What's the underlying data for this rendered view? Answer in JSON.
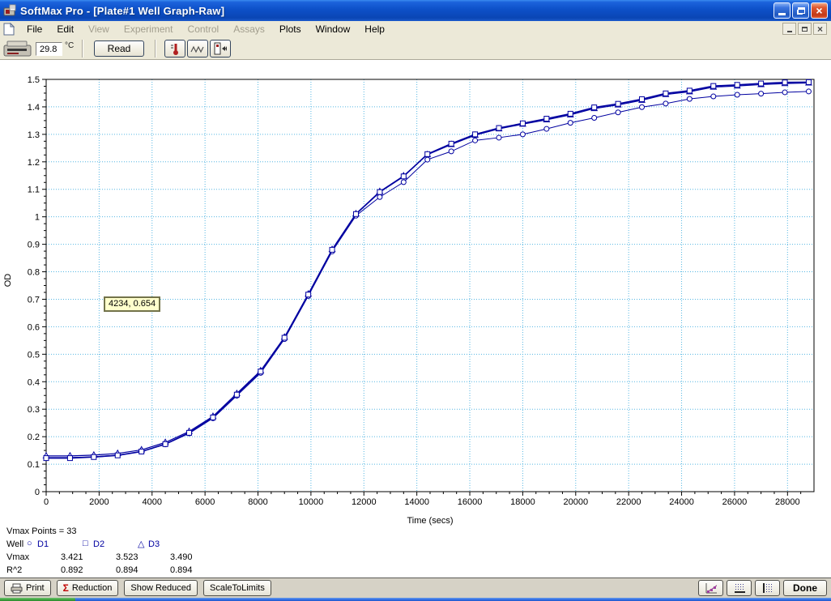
{
  "window": {
    "title": "SoftMax Pro - [Plate#1 Well Graph-Raw]",
    "controls": {
      "minimize": "minimize",
      "restore": "restore",
      "close": "×"
    }
  },
  "menu": {
    "items": [
      {
        "label": "File",
        "enabled": true
      },
      {
        "label": "Edit",
        "enabled": true
      },
      {
        "label": "View",
        "enabled": false
      },
      {
        "label": "Experiment",
        "enabled": false
      },
      {
        "label": "Control",
        "enabled": false
      },
      {
        "label": "Assays",
        "enabled": false
      },
      {
        "label": "Plots",
        "enabled": true
      },
      {
        "label": "Window",
        "enabled": true
      },
      {
        "label": "Help",
        "enabled": true
      }
    ]
  },
  "toolbar": {
    "temperature": "29.8",
    "temperature_unit": "°C",
    "read_label": "Read",
    "icon_buttons": [
      "thermometer-icon",
      "kinetic-waveform-icon",
      "plate-in-out-icon"
    ]
  },
  "tooltip": {
    "text": "4234, 0.654",
    "bg": "#FFFFCC"
  },
  "chart_data": {
    "type": "line",
    "title": "",
    "xlabel": "Time (secs)",
    "ylabel": "OD",
    "xlim": [
      0,
      29000
    ],
    "ylim": [
      0,
      1.5
    ],
    "grid": true,
    "grid_color": "#55B6E2",
    "line_color": "#0000A0",
    "x_ticks": [
      0,
      2000,
      4000,
      6000,
      8000,
      10000,
      12000,
      14000,
      16000,
      18000,
      20000,
      22000,
      24000,
      26000,
      28000
    ],
    "x_tick_labels": [
      "0",
      "2000",
      "4000",
      "6000",
      "8000",
      "10000",
      "12000",
      "14000",
      "16000",
      "18000",
      "20000",
      "22000",
      "24000",
      "26000",
      "28000"
    ],
    "y_ticks": [
      0,
      0.1,
      0.2,
      0.3,
      0.4,
      0.5,
      0.6,
      0.7,
      0.8,
      0.9,
      1,
      1.1,
      1.2,
      1.3,
      1.4,
      1.5
    ],
    "y_tick_labels": [
      "0",
      "0.1",
      "0.2",
      "0.3",
      "0.4",
      "0.5",
      "0.6",
      "0.7",
      "0.8",
      "0.9",
      "1",
      "1.1",
      "1.2",
      "1.3",
      "1.4",
      "1.5"
    ],
    "x": [
      0,
      900,
      1800,
      2700,
      3600,
      4500,
      5400,
      6300,
      7200,
      8100,
      9000,
      9900,
      10800,
      11700,
      12600,
      13500,
      14400,
      15300,
      16200,
      17100,
      18000,
      18900,
      19800,
      20700,
      21600,
      22500,
      23400,
      24300,
      25200,
      26100,
      27000,
      27900,
      28800
    ],
    "series": [
      {
        "name": "D1",
        "marker": "circle",
        "values": [
          0.124,
          0.124,
          0.127,
          0.133,
          0.146,
          0.172,
          0.212,
          0.267,
          0.349,
          0.432,
          0.555,
          0.712,
          0.874,
          1.004,
          1.072,
          1.126,
          1.208,
          1.238,
          1.278,
          1.288,
          1.3,
          1.32,
          1.342,
          1.36,
          1.38,
          1.399,
          1.412,
          1.429,
          1.438,
          1.444,
          1.448,
          1.453,
          1.456
        ]
      },
      {
        "name": "D2",
        "marker": "square",
        "values": [
          0.122,
          0.122,
          0.126,
          0.132,
          0.146,
          0.173,
          0.214,
          0.27,
          0.353,
          0.437,
          0.56,
          0.717,
          0.88,
          1.01,
          1.09,
          1.147,
          1.228,
          1.266,
          1.3,
          1.323,
          1.34,
          1.357,
          1.375,
          1.398,
          1.411,
          1.428,
          1.449,
          1.459,
          1.476,
          1.48,
          1.485,
          1.489,
          1.49
        ]
      },
      {
        "name": "D3",
        "marker": "triangle",
        "values": [
          0.13,
          0.13,
          0.133,
          0.139,
          0.152,
          0.179,
          0.219,
          0.274,
          0.357,
          0.44,
          0.562,
          0.719,
          0.881,
          1.011,
          1.092,
          1.149,
          1.226,
          1.263,
          1.297,
          1.32,
          1.337,
          1.353,
          1.371,
          1.394,
          1.407,
          1.424,
          1.445,
          1.455,
          1.472,
          1.476,
          1.481,
          1.485,
          1.487
        ]
      }
    ]
  },
  "results": {
    "vmax_points_label": "Vmax Points = 33",
    "well_label": "Well",
    "vmax_label": "Vmax",
    "r2_label": "R^2",
    "wells": [
      {
        "name": "D1",
        "marker_glyph": "○",
        "vmax": "3.421",
        "r2": "0.892"
      },
      {
        "name": "D2",
        "marker_glyph": "□",
        "vmax": "3.523",
        "r2": "0.894"
      },
      {
        "name": "D3",
        "marker_glyph": "△",
        "vmax": "3.490",
        "r2": "0.894"
      }
    ]
  },
  "bottom_toolbar": {
    "print_label": "Print",
    "reduction_label": "Reduction",
    "reduction_sigma": "Σ",
    "show_reduced_label": "Show Reduced",
    "scale_to_limits_label": "ScaleToLimits",
    "done_label": "Done",
    "icon_buttons": [
      "mini-chart-icon",
      "grid-bottom-axis-icon",
      "grid-left-axis-icon"
    ]
  },
  "colors": {
    "accent_blue": "#0000A0",
    "grid_blue": "#55B6E2",
    "titlebar_blue": "#0D50C8",
    "chrome_tan": "#ECE9D8",
    "tooltip_bg": "#FFFFCC",
    "taskbar_green": "#379A37",
    "taskbar_blue": "#2E6BE5"
  }
}
